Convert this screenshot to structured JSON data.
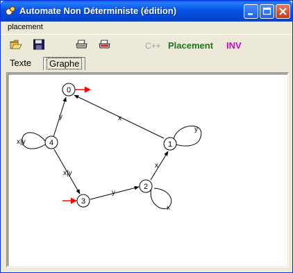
{
  "window": {
    "title": "Automate Non Déterministe (édition)"
  },
  "menu": {
    "placement": "placement"
  },
  "toolbar": {
    "icons": [
      "open-folder-icon",
      "save-disk-icon",
      "print-icon",
      "print-preview-icon"
    ],
    "cpp": "C++",
    "placement": "Placement",
    "inv": "INV",
    "colors": {
      "cpp": "#a0a0a0",
      "placement": "#1a7a1a",
      "inv": "#d000d0"
    }
  },
  "tabs": {
    "texte": "Texte",
    "graphe": "Graphe",
    "selected": "Graphe"
  },
  "graph": {
    "states": [
      "0",
      "1",
      "2",
      "3",
      "4"
    ],
    "edge_labels": {
      "e_1_0": "x",
      "e_4_0": "y",
      "e_4_3": "x|y",
      "e_3_2": "y",
      "e_2_1": "x",
      "loop_1": "y",
      "loop_2": "x",
      "loop_4": "x|y"
    },
    "initial_states": [
      "3"
    ],
    "final_states": [
      "0"
    ],
    "marker_color": "#ff0000"
  }
}
